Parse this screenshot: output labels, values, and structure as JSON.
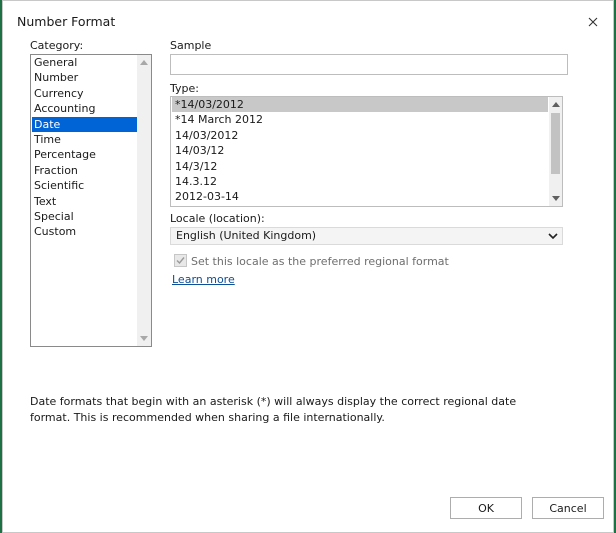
{
  "dialog": {
    "title": "Number Format"
  },
  "category": {
    "label": "Category:",
    "items": [
      "General",
      "Number",
      "Currency",
      "Accounting",
      "Date",
      "Time",
      "Percentage",
      "Fraction",
      "Scientific",
      "Text",
      "Special",
      "Custom"
    ],
    "selected": "Date"
  },
  "sample": {
    "label": "Sample",
    "value": ""
  },
  "type": {
    "label": "Type:",
    "items": [
      "*14/03/2012",
      "*14 March 2012",
      "14/03/2012",
      "14/03/12",
      "14/3/12",
      "14.3.12",
      "2012-03-14"
    ],
    "selected": "*14/03/2012"
  },
  "locale": {
    "label": "Locale (location):",
    "value": "English (United Kingdom)"
  },
  "preferred": {
    "label": "Set this locale as the preferred regional format",
    "checked": true
  },
  "learn_more": "Learn more",
  "description": "Date formats that begin with an asterisk (*) will always display the correct regional date format. This is recommended when sharing a file internationally.",
  "buttons": {
    "ok": "OK",
    "cancel": "Cancel"
  },
  "colors": {
    "selection": "#0063d6",
    "link": "#0b4e9a",
    "type_selection": "#c8c8c8"
  }
}
